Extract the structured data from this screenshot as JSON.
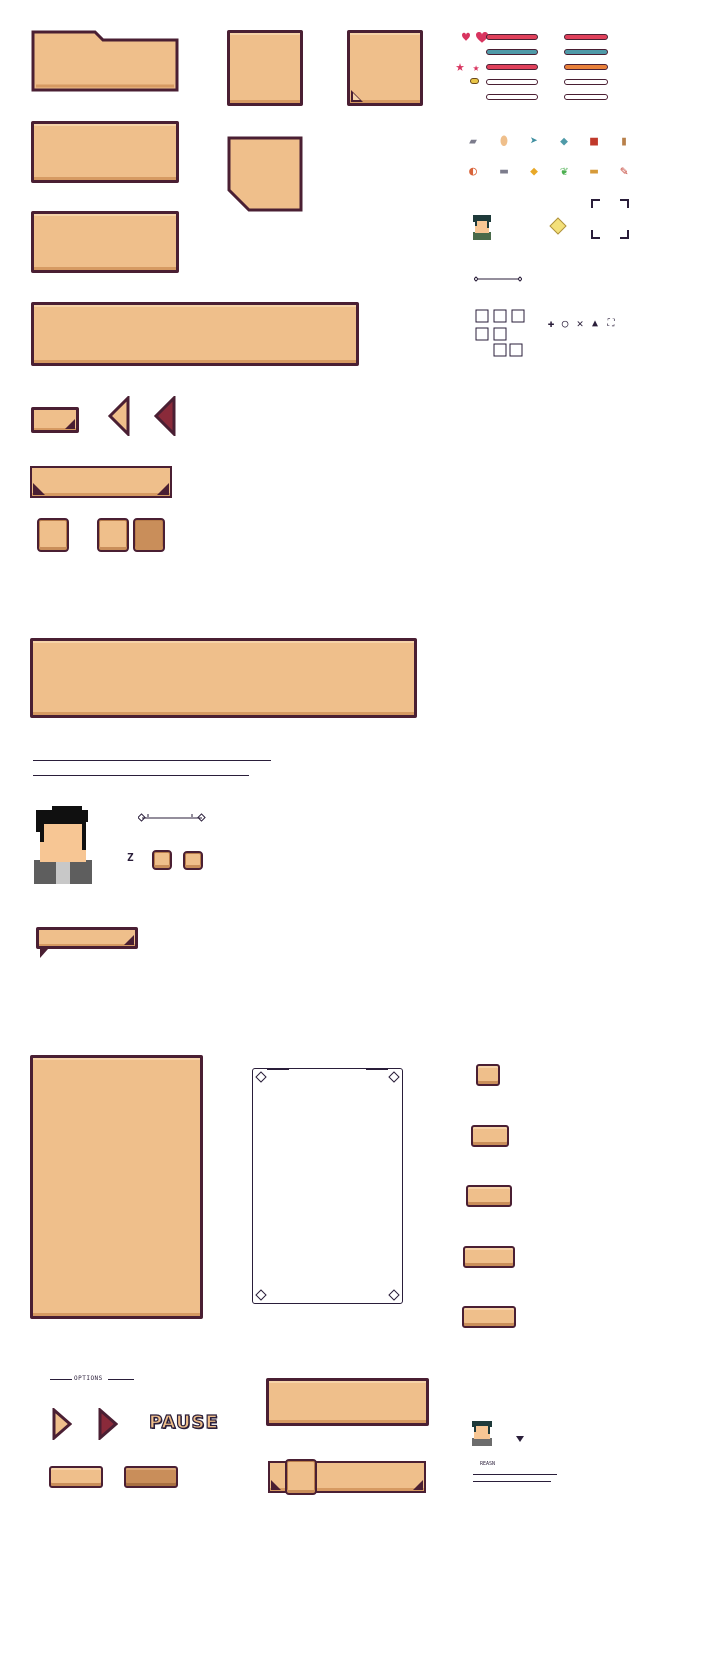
{
  "pause_label": "PAUSE",
  "options_label": "OPTIONS",
  "reason_label": "REASN",
  "key_hint": "Z",
  "colors": {
    "panel_fill": "#efbf8b",
    "panel_border": "#4a1f33",
    "panel_shadow": "#d69a62",
    "button_dark": "#c98e5a",
    "health_red": "#e0415b",
    "mana_teal": "#4f9aa8",
    "stamina_orange": "#e8813a",
    "heart_pink": "#d8345f"
  },
  "status_bars": [
    {
      "icon": "heart-icon",
      "fill": "health"
    },
    {
      "icon": "heart-icon",
      "fill": "mana"
    },
    {
      "icon": "star-icon",
      "fill": "health"
    },
    {
      "icon": "coin-icon",
      "fill": "empty"
    },
    {
      "icon": "none",
      "fill": "empty"
    }
  ],
  "items": [
    {
      "icon": "stone-icon",
      "glyph": "▰"
    },
    {
      "icon": "egg-icon",
      "glyph": "●"
    },
    {
      "icon": "fish-icon",
      "glyph": "➤"
    },
    {
      "icon": "candy-icon",
      "glyph": "◆"
    },
    {
      "icon": "book-icon",
      "glyph": "■"
    },
    {
      "icon": "log-icon",
      "glyph": "▮"
    },
    {
      "icon": "meat-icon",
      "glyph": "◐"
    },
    {
      "icon": "iron-bar-icon",
      "glyph": "▬"
    },
    {
      "icon": "cheese-icon",
      "glyph": "◆"
    },
    {
      "icon": "leaf-icon",
      "glyph": "❦"
    },
    {
      "icon": "plank-icon",
      "glyph": "▬"
    },
    {
      "icon": "pencil-icon",
      "glyph": "✎"
    }
  ],
  "action_glyphs": [
    "✚",
    "○",
    "✕",
    "▲",
    "⛶"
  ]
}
